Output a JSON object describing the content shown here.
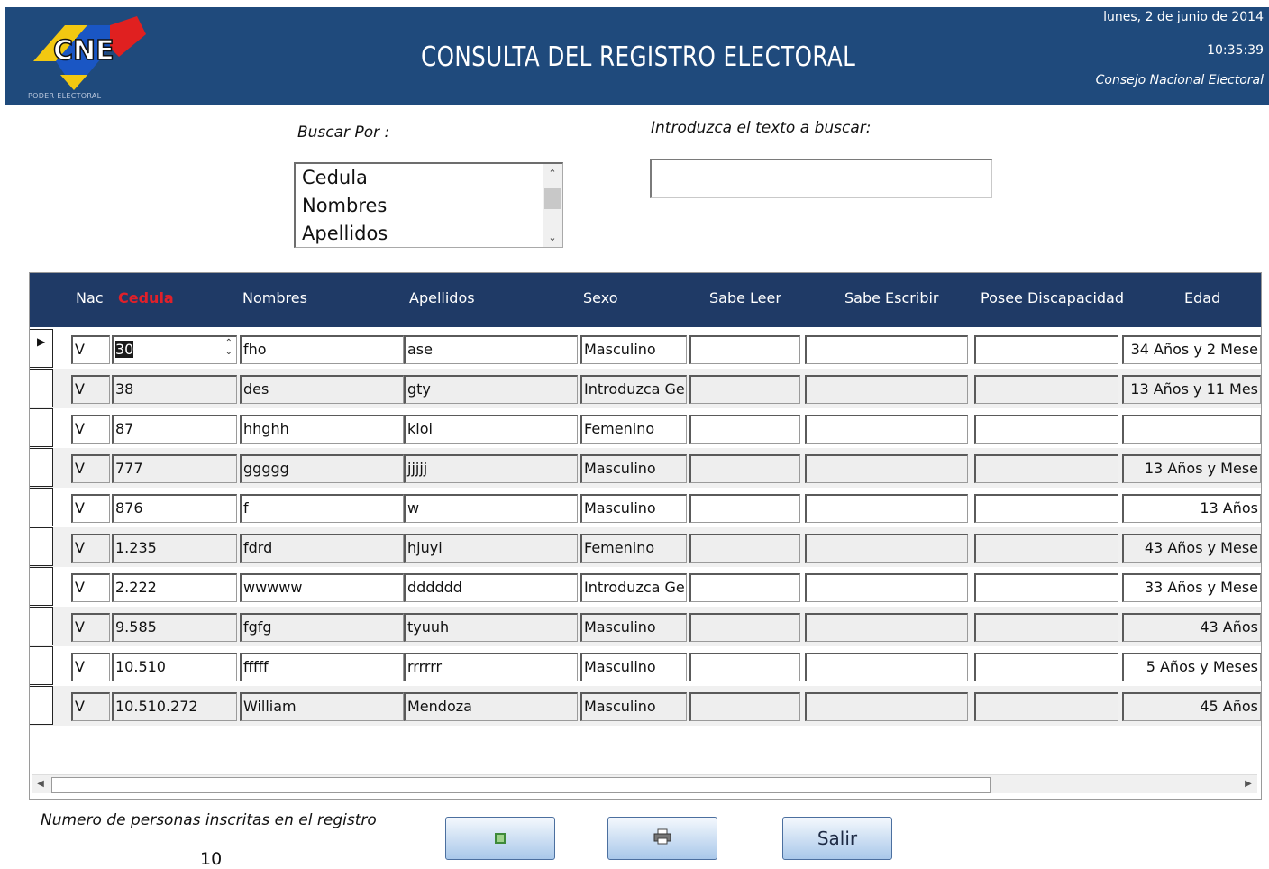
{
  "header": {
    "title": "CONSULTA DEL REGISTRO ELECTORAL",
    "date": "lunes, 2 de junio de 2014",
    "time": "10:35:39",
    "organization": "Consejo Nacional Electoral",
    "logo_text": "CNE",
    "logo_subtext": "PODER ELECTORAL"
  },
  "search": {
    "by_label": "Buscar Por :",
    "options": [
      "Cedula",
      "Nombres",
      "Apellidos"
    ],
    "text_label": "Introduzca el texto a buscar:",
    "text_value": ""
  },
  "grid": {
    "columns": [
      "Nac",
      "Cedula",
      "Nombres",
      "Apellidos",
      "Sexo",
      "Sabe Leer",
      "Sabe Escribir",
      "Posee Discapacidad",
      "Edad"
    ],
    "rows": [
      {
        "nac": "V",
        "cedula": "30",
        "nombres": "fho",
        "apellidos": "ase",
        "sexo": "Masculino",
        "sabe_leer": "",
        "sabe_escribir": "",
        "discapacidad": "",
        "edad": "34 Años y 2 Mese"
      },
      {
        "nac": "V",
        "cedula": "38",
        "nombres": "des",
        "apellidos": "gty",
        "sexo": "Introduzca Ger",
        "sabe_leer": "",
        "sabe_escribir": "",
        "discapacidad": "",
        "edad": "13 Años y 11 Mes"
      },
      {
        "nac": "V",
        "cedula": "87",
        "nombres": "hhghh",
        "apellidos": "kloi",
        "sexo": "Femenino",
        "sabe_leer": "",
        "sabe_escribir": "",
        "discapacidad": "",
        "edad": ""
      },
      {
        "nac": "V",
        "cedula": "777",
        "nombres": "ggggg",
        "apellidos": "jjjjj",
        "sexo": "Masculino",
        "sabe_leer": "",
        "sabe_escribir": "",
        "discapacidad": "",
        "edad": "13 Años y  Mese"
      },
      {
        "nac": "V",
        "cedula": "876",
        "nombres": "f",
        "apellidos": "w",
        "sexo": "Masculino",
        "sabe_leer": "",
        "sabe_escribir": "",
        "discapacidad": "",
        "edad": "13 Años"
      },
      {
        "nac": "V",
        "cedula": "1.235",
        "nombres": "fdrd",
        "apellidos": "hjuyi",
        "sexo": "Femenino",
        "sabe_leer": "",
        "sabe_escribir": "",
        "discapacidad": "",
        "edad": "43 Años y  Mese"
      },
      {
        "nac": "V",
        "cedula": "2.222",
        "nombres": "wwwww",
        "apellidos": "dddddd",
        "sexo": "Introduzca Ger",
        "sabe_leer": "",
        "sabe_escribir": "",
        "discapacidad": "",
        "edad": "33 Años y  Mese"
      },
      {
        "nac": "V",
        "cedula": "9.585",
        "nombres": "fgfg",
        "apellidos": "tyuuh",
        "sexo": "Masculino",
        "sabe_leer": "",
        "sabe_escribir": "",
        "discapacidad": "",
        "edad": "43 Años"
      },
      {
        "nac": "V",
        "cedula": "10.510",
        "nombres": "fffff",
        "apellidos": "rrrrrr",
        "sexo": "Masculino",
        "sabe_leer": "",
        "sabe_escribir": "",
        "discapacidad": "",
        "edad": "5 Años y  Meses"
      },
      {
        "nac": "V",
        "cedula": "10.510.272",
        "nombres": "William",
        "apellidos": "Mendoza",
        "sexo": "Masculino",
        "sabe_leer": "",
        "sabe_escribir": "",
        "discapacidad": "",
        "edad": "45 Años"
      }
    ]
  },
  "footer": {
    "count_label": "Numero de personas inscritas en el registro",
    "count_value": "10",
    "buttons": [
      {
        "label": "",
        "icon": "export-icon"
      },
      {
        "label": "",
        "icon": "printer-icon"
      },
      {
        "label": "Salir",
        "icon": ""
      }
    ]
  },
  "colors": {
    "header_bg": "#1f4a7c",
    "grid_header_bg": "#1f3a66",
    "sorted_column": "#e0202a",
    "button_gradient_bottom": "#a9c8ea"
  }
}
